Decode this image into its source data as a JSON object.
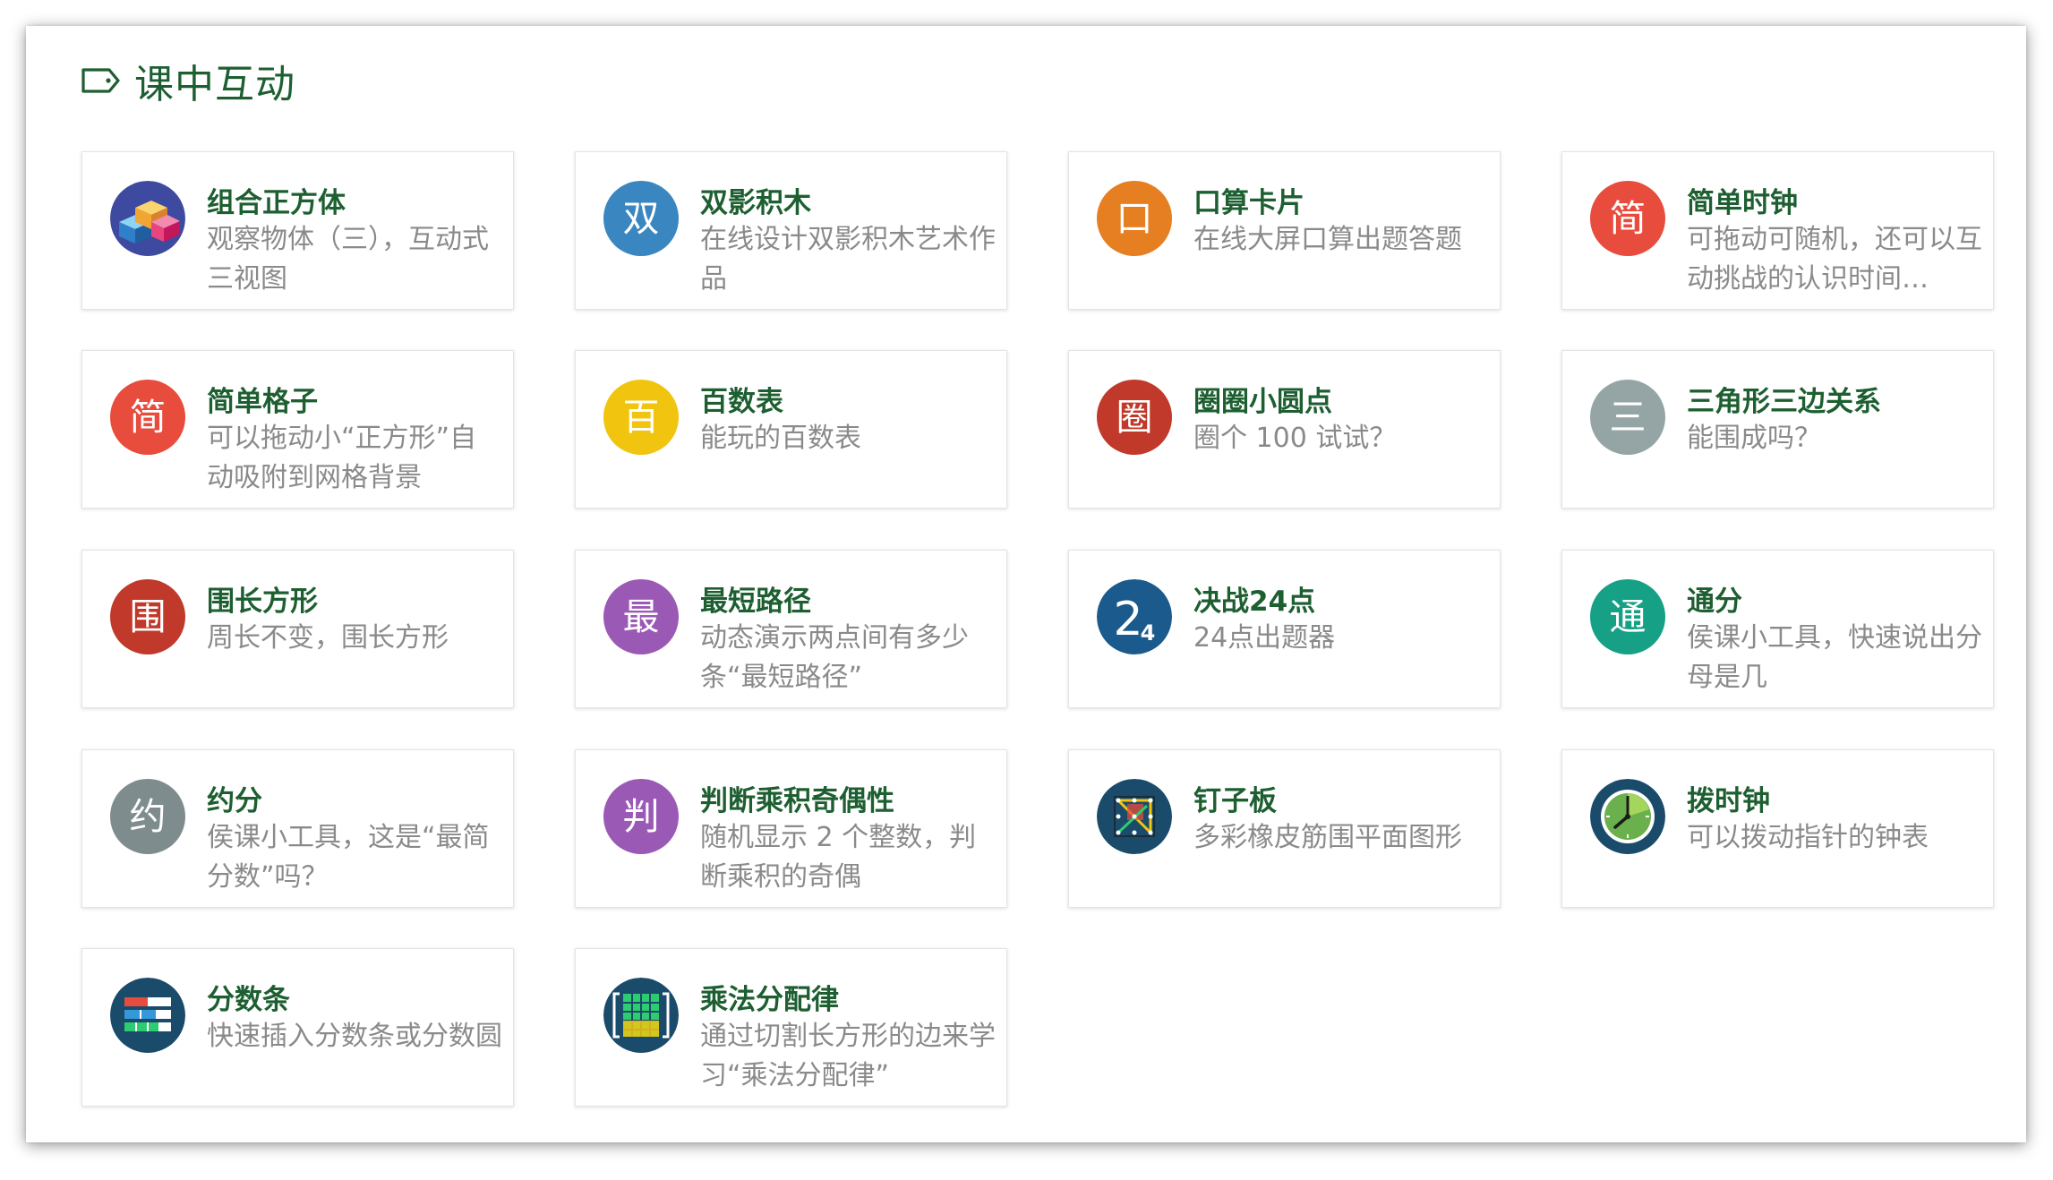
{
  "panel": {
    "title": "课中互动",
    "icon": "tag-icon"
  },
  "cards": [
    {
      "title": "组合正方体",
      "desc": "观察物体（三），互动式三视图",
      "icon": "cube-blocks-icon",
      "color": "#3e4aa0"
    },
    {
      "title": "双影积木",
      "desc": "在线设计双影积木艺术作品",
      "icon": "letter-icon",
      "glyph": "双",
      "color": "#3a86c0"
    },
    {
      "title": "口算卡片",
      "desc": "在线大屏口算出题答题",
      "icon": "letter-icon",
      "glyph": "口",
      "color": "#e67e22"
    },
    {
      "title": "简单时钟",
      "desc": "可拖动可随机，还可以互动挑战的认识时间…",
      "icon": "letter-icon",
      "glyph": "简",
      "color": "#e74c3c"
    },
    {
      "title": "简单格子",
      "desc": "可以拖动小“正方形”自动吸附到网格背景",
      "icon": "letter-icon",
      "glyph": "简",
      "color": "#e74c3c"
    },
    {
      "title": "百数表",
      "desc": "能玩的百数表",
      "icon": "letter-icon",
      "glyph": "百",
      "color": "#f1c40f"
    },
    {
      "title": "圈圈小圆点",
      "desc": "圈个 100 试试？",
      "icon": "letter-icon",
      "glyph": "圈",
      "color": "#c0392b"
    },
    {
      "title": "三角形三边关系",
      "desc": "能围成吗？",
      "icon": "letter-icon",
      "glyph": "三",
      "color": "#95a5a6"
    },
    {
      "title": "围长方形",
      "desc": "周长不变，围长方形",
      "icon": "letter-icon",
      "glyph": "围",
      "color": "#c0392b"
    },
    {
      "title": "最短路径",
      "desc": "动态演示两点间有多少条“最短路径”",
      "icon": "letter-icon",
      "glyph": "最",
      "color": "#9b59b6"
    },
    {
      "title": "决战24点",
      "desc": "24点出题器",
      "icon": "number-24-icon",
      "glyph": "24",
      "color": "#1b5a8c"
    },
    {
      "title": "通分",
      "desc": "侯课小工具，快速说出分母是几",
      "icon": "letter-icon",
      "glyph": "通",
      "color": "#16a085"
    },
    {
      "title": "约分",
      "desc": "侯课小工具，这是“最简分数”吗？",
      "icon": "letter-icon",
      "glyph": "约",
      "color": "#7f8c8d"
    },
    {
      "title": "判断乘积奇偶性",
      "desc": "随机显示 2 个整数，判断乘积的奇偶",
      "icon": "letter-icon",
      "glyph": "判",
      "color": "#9b59b6"
    },
    {
      "title": "钉子板",
      "desc": "多彩橡皮筋围平面图形",
      "icon": "pegboard-icon",
      "color": "#1b4b6b"
    },
    {
      "title": "拨时钟",
      "desc": "可以拨动指针的钟表",
      "icon": "clock-icon",
      "color": "#1b4b6b"
    },
    {
      "title": "分数条",
      "desc": "快速插入分数条或分数圆",
      "icon": "fraction-bars-icon",
      "color": "#1b4b6b"
    },
    {
      "title": "乘法分配律",
      "desc": "通过切割长方形的边来学习“乘法分配律”",
      "icon": "grid-matrix-icon",
      "color": "#1b4b6b"
    }
  ]
}
